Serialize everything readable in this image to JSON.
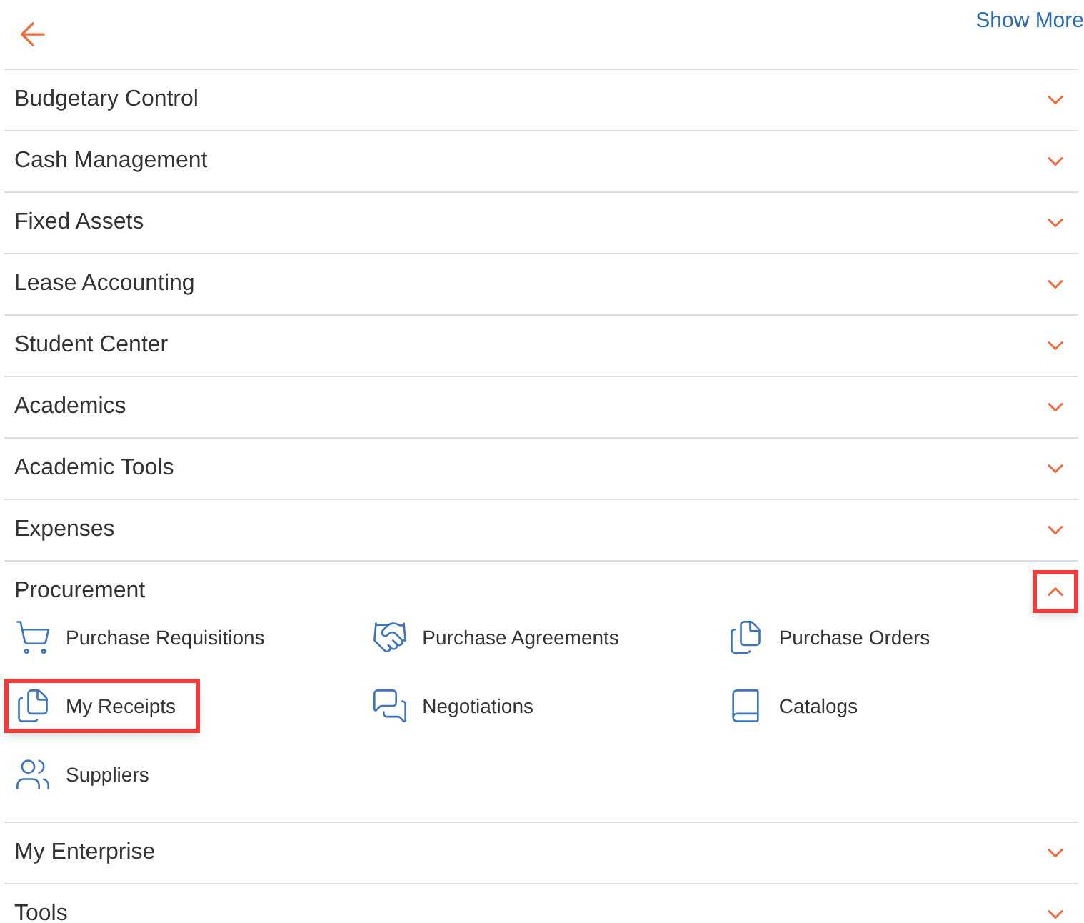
{
  "header": {
    "link": "Show More"
  },
  "sections": [
    {
      "label": "Budgetary Control",
      "expanded": false,
      "toggle_highlighted": false
    },
    {
      "label": "Cash Management",
      "expanded": false,
      "toggle_highlighted": false
    },
    {
      "label": "Fixed Assets",
      "expanded": false,
      "toggle_highlighted": false
    },
    {
      "label": "Lease Accounting",
      "expanded": false,
      "toggle_highlighted": false
    },
    {
      "label": "Student Center",
      "expanded": false,
      "toggle_highlighted": false
    },
    {
      "label": "Academics",
      "expanded": false,
      "toggle_highlighted": false
    },
    {
      "label": "Academic Tools",
      "expanded": false,
      "toggle_highlighted": false
    },
    {
      "label": "Expenses",
      "expanded": false,
      "toggle_highlighted": false
    },
    {
      "label": "Procurement",
      "expanded": true,
      "toggle_highlighted": true,
      "items": [
        {
          "label": "Purchase Requisitions",
          "highlighted": false
        },
        {
          "label": "Purchase Agreements",
          "highlighted": false
        },
        {
          "label": "Purchase Orders",
          "highlighted": false
        },
        {
          "label": "My Receipts",
          "highlighted": true
        },
        {
          "label": "Negotiations",
          "highlighted": false
        },
        {
          "label": "Catalogs",
          "highlighted": false
        },
        {
          "label": "Suppliers",
          "highlighted": false
        }
      ]
    },
    {
      "label": "My Enterprise",
      "expanded": false,
      "toggle_highlighted": false
    },
    {
      "label": "Tools",
      "expanded": false,
      "toggle_highlighted": false
    }
  ]
}
